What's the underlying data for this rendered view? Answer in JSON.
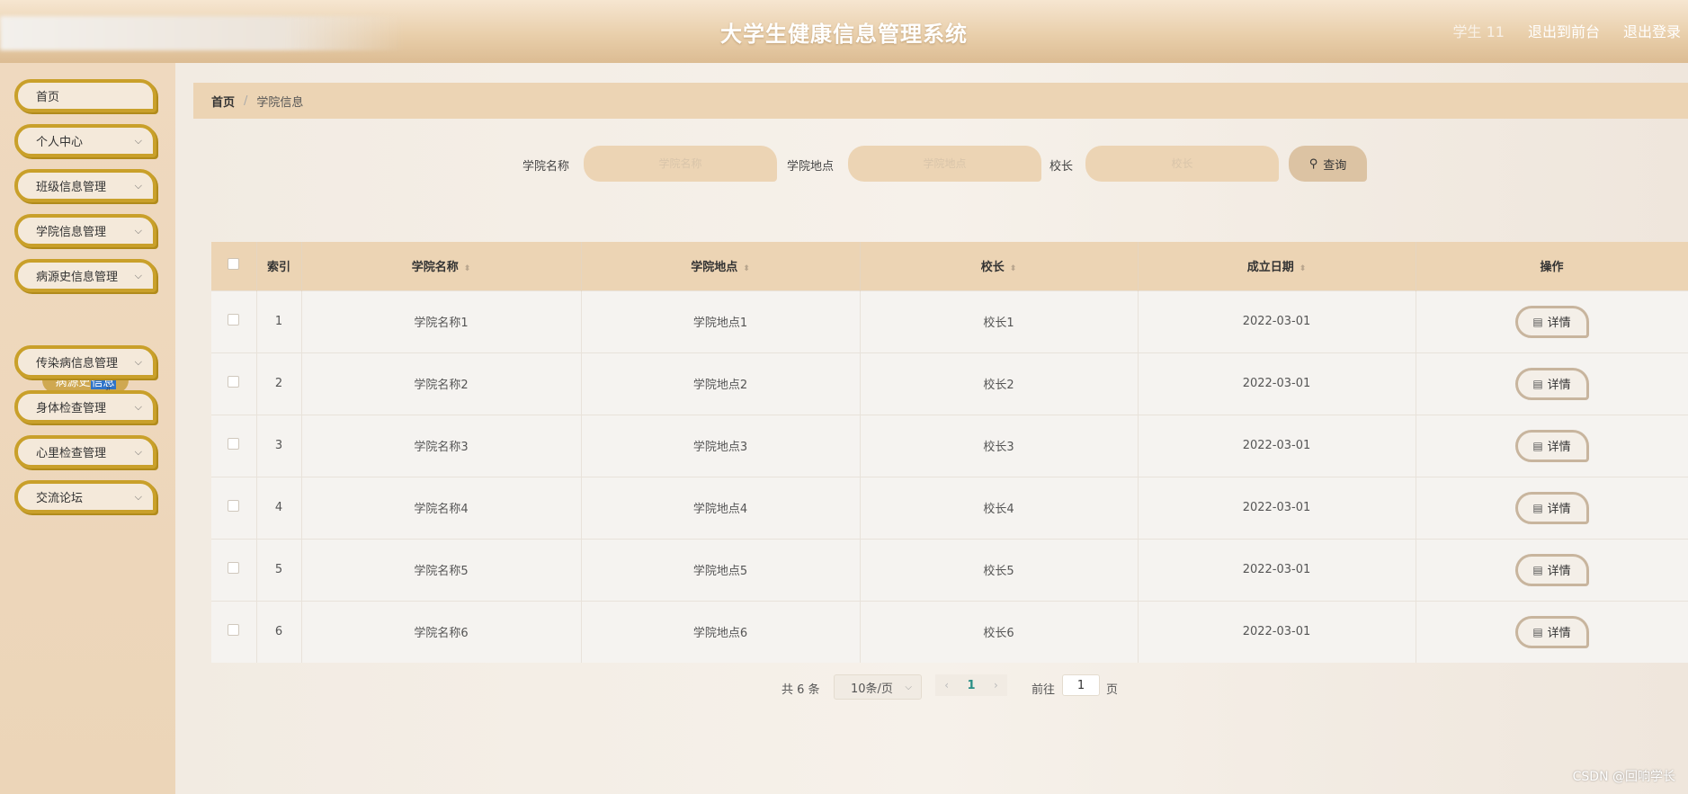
{
  "header": {
    "title": "大学生健康信息管理系统",
    "user": "学生 11",
    "front_link": "退出到前台",
    "logout": "退出登录"
  },
  "sidebar": {
    "items": [
      {
        "label": "首页",
        "has_chevron": false
      },
      {
        "label": "个人中心",
        "has_chevron": true
      },
      {
        "label": "班级信息管理",
        "has_chevron": true
      },
      {
        "label": "学院信息管理",
        "has_chevron": true
      },
      {
        "label": "病源史信息管理",
        "has_chevron": true
      },
      {
        "label": "传染病信息管理",
        "has_chevron": true
      },
      {
        "label": "身体检查管理",
        "has_chevron": true
      },
      {
        "label": "心里检查管理",
        "has_chevron": true
      },
      {
        "label": "交流论坛",
        "has_chevron": true
      }
    ],
    "submenu": {
      "part1": "病源史",
      "part2": "信息"
    }
  },
  "breadcrumb": {
    "home": "首页",
    "sep": "/",
    "current": "学院信息"
  },
  "search": {
    "college_name_label": "学院名称",
    "college_name_placeholder": "学院名称",
    "college_location_label": "学院地点",
    "college_location_placeholder": "学院地点",
    "president_label": "校长",
    "president_placeholder": "校长",
    "button": "查询"
  },
  "table": {
    "headers": [
      "索引",
      "学院名称",
      "学院地点",
      "校长",
      "成立日期",
      "操作"
    ],
    "rows": [
      {
        "index": "1",
        "name": "学院名称1",
        "location": "学院地点1",
        "president": "校长1",
        "date": "2022-03-01",
        "action": "详情"
      },
      {
        "index": "2",
        "name": "学院名称2",
        "location": "学院地点2",
        "president": "校长2",
        "date": "2022-03-01",
        "action": "详情"
      },
      {
        "index": "3",
        "name": "学院名称3",
        "location": "学院地点3",
        "president": "校长3",
        "date": "2022-03-01",
        "action": "详情"
      },
      {
        "index": "4",
        "name": "学院名称4",
        "location": "学院地点4",
        "president": "校长4",
        "date": "2022-03-01",
        "action": "详情"
      },
      {
        "index": "5",
        "name": "学院名称5",
        "location": "学院地点5",
        "president": "校长5",
        "date": "2022-03-01",
        "action": "详情"
      },
      {
        "index": "6",
        "name": "学院名称6",
        "location": "学院地点6",
        "president": "校长6",
        "date": "2022-03-01",
        "action": "详情"
      }
    ]
  },
  "pagination": {
    "total": "共 6 条",
    "page_size": "10条/页",
    "current_page": "1",
    "goto_label": "前往",
    "goto_value": "1",
    "page_unit": "页"
  },
  "watermark": "CSDN @回响学长",
  "colors": {
    "accent_gold": "#c9a02a",
    "header_tan": "#e9cfab",
    "table_header": "#ecd4b4",
    "selection_blue": "#2f74c9"
  }
}
